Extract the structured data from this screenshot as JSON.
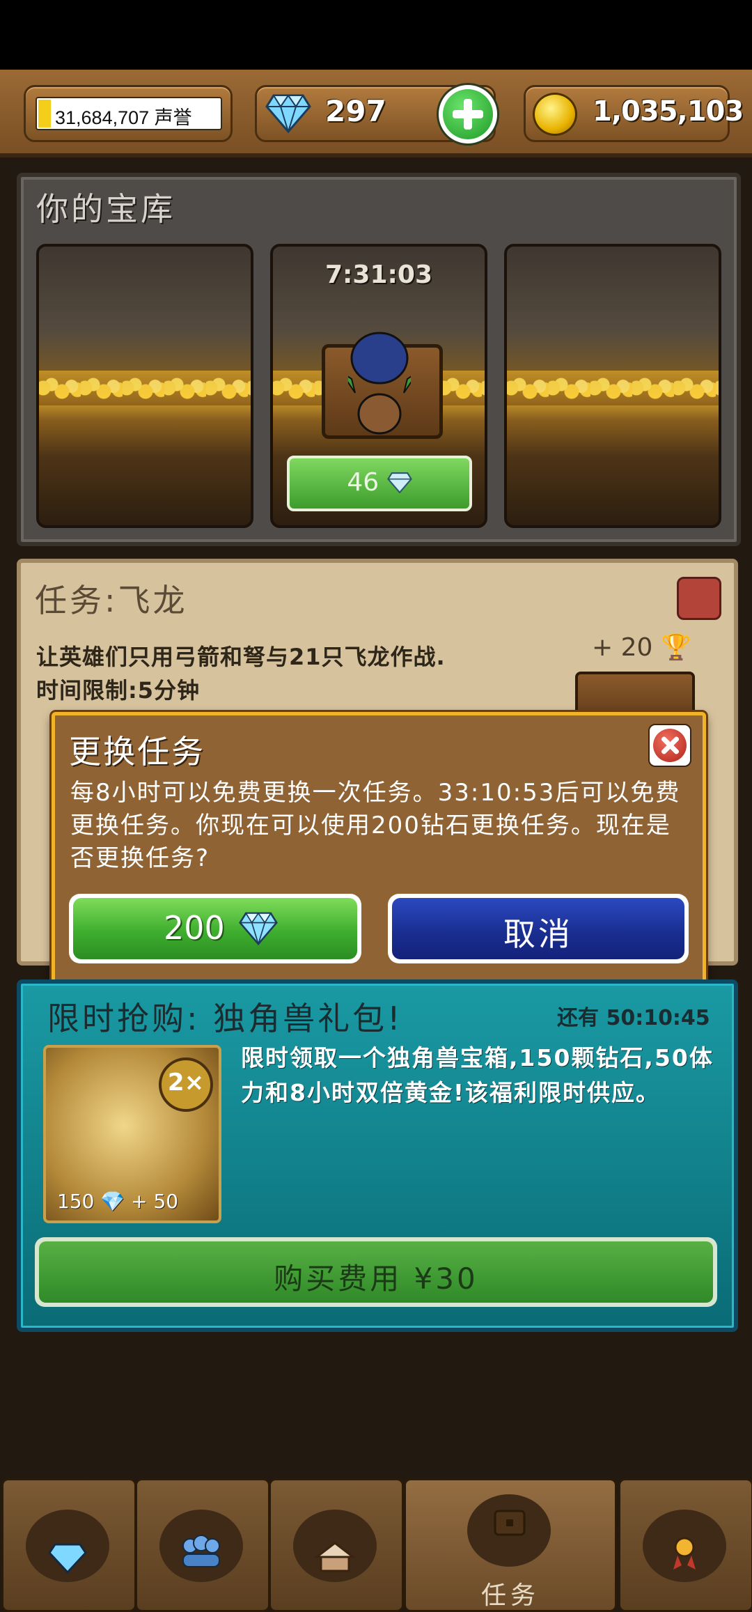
{
  "topbar": {
    "fame_text": "31,684,707 声誉",
    "gems": "297",
    "gold": "1,035,103"
  },
  "vault": {
    "title": "你的宝库",
    "slot_timer": "7:31:03",
    "open_cost": "46"
  },
  "quest": {
    "title": "任务:飞龙",
    "description": "让英雄们只用弓箭和弩与21只飞龙作战.",
    "time_limit": "时间限制:5分钟",
    "reward": "+ 20"
  },
  "modal": {
    "title": "更换任务",
    "body": "每8小时可以免费更换一次任务。33:10:53后可以免费更换任务。你现在可以使用200钻石更换任务。现在是否更换任务?",
    "confirm_label": "200",
    "cancel_label": "取消"
  },
  "offer": {
    "title": "限时抢购: 独角兽礼包!",
    "remaining": "还有 50:10:45",
    "badge": "2×",
    "card_caption": "150 💎 + 50",
    "description": "限时领取一个独角兽宝箱,150颗钻石,50体力和8小时双倍黄金!该福利限时供应。",
    "buy_label": "购买费用 ¥30"
  },
  "nav": {
    "tabs": [
      "gem-shop",
      "heroes",
      "village",
      "任务",
      "achievements"
    ],
    "active_label": "任务"
  },
  "colors": {
    "confirm": "#3fae2f",
    "cancel": "#1a2f92",
    "modal_border": "#f1b428",
    "offer": "#0a6b75"
  }
}
